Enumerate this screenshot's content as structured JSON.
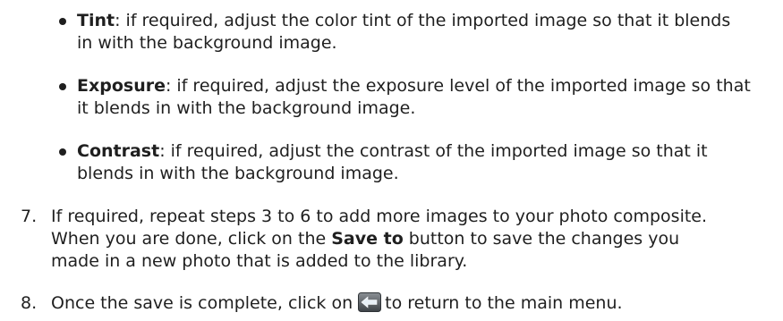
{
  "bullets": [
    {
      "term": "Tint",
      "line1_rest": ": if required, adjust the color tint of the imported image so that it blends",
      "line2": "in with the background image."
    },
    {
      "term": "Exposure",
      "line1_rest": ": if required, adjust the exposure level of the imported image so that",
      "line2": "it blends in with the background image."
    },
    {
      "term": "Contrast",
      "line1_rest": ": if required, adjust the contrast of the imported image so that it",
      "line2": "blends in with the background image."
    }
  ],
  "steps": [
    {
      "number": "7.",
      "line1": "If required, repeat steps 3 to 6 to add more images to your photo composite.",
      "line2_pre": "When you are done, click on the ",
      "line2_bold": "Save to",
      "line2_post": " button to save the changes you",
      "line3": "made in a new photo that is added to the library."
    },
    {
      "number": "8.",
      "text_pre": "Once the save is complete, click on",
      "icon": "back-arrow-icon",
      "text_post": "to return to the main menu."
    }
  ]
}
